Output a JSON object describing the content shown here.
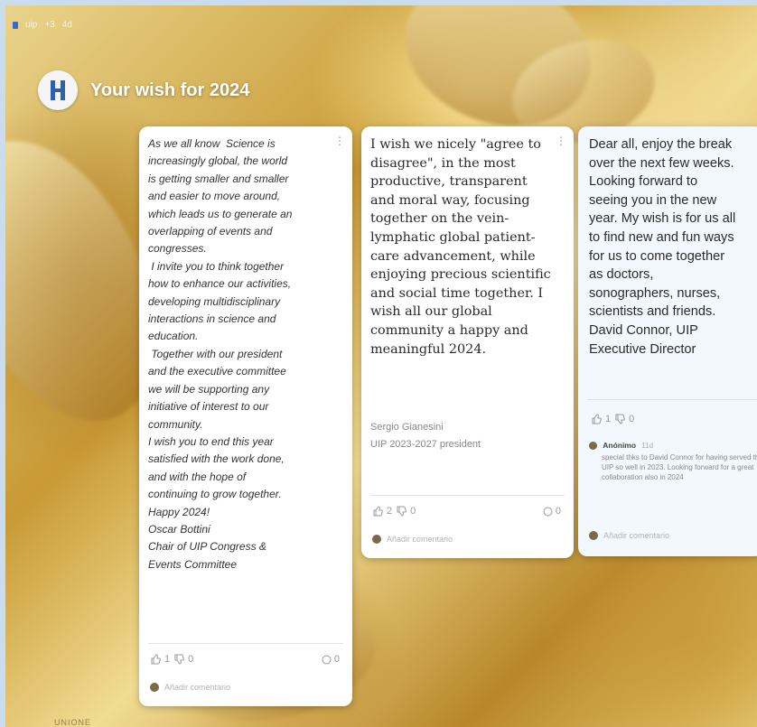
{
  "topbar": {
    "items": [
      "uip",
      "+3",
      "4d"
    ]
  },
  "board": {
    "title": "Your wish for 2024"
  },
  "cards": [
    {
      "body": "As we all know  Science is\nincreasingly global, the world\nis getting smaller and smaller\nand easier to move around,\nwhich leads us to generate an\noverlapping of events and\ncongresses.\n I invite you to think together\nhow to enhance our activities,\ndeveloping multidisciplinary\ninteractions in science and\neducation.\n Together with our president\nand the executive committee\nwe will be supporting any\ninitiative of interest to our\ncommunity.\nI wish you to end this year\nsatisfied with the work done,\nand with the hope of\ncontinuing to grow together.\nHappy 2024!\nOscar Bottini\nChair of UIP Congress &\nEvents Committee",
      "likes": "1",
      "dislikes": "0",
      "comments": "0",
      "add_comment": "Añadir comentario"
    },
    {
      "body": "I wish we nicely \"agree to disagree\", in the most productive, transparent and moral way, focusing together on the vein-lymphatic global patient-care advancement, while enjoying precious scientific and social time together. I wish all our global community a happy and meaningful 2024.",
      "signature_name": "Sergio Gianesini",
      "signature_role": "UIP 2023-2027 president",
      "likes": "2",
      "dislikes": "0",
      "comments": "0",
      "add_comment": "Añadir comentario"
    },
    {
      "body": "Dear all, enjoy the break\nover the next few weeks.\nLooking forward to\nseeing you in the new\nyear. My wish is for us all\nto find new and fun ways\nfor us to come together\nas doctors,\nsonographers, nurses,\nscientists and friends.\nDavid Connor, UIP\nExecutive Director",
      "likes": "1",
      "dislikes": "0",
      "comment": {
        "author": "Anónimo",
        "time": "11d",
        "text": "special thks to David Connor for having served the UIP so well in 2023. Looking forward for a great collaboration also in 2024"
      },
      "add_comment": "Añadir comentario"
    }
  ],
  "footer": {
    "text": "UNIONE"
  }
}
